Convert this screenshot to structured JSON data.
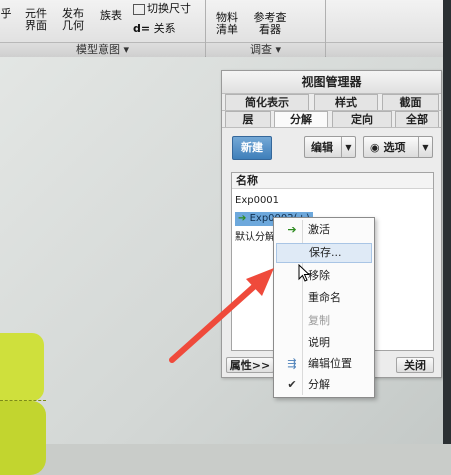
{
  "ribbon": {
    "partial_left": "乎",
    "yuanjian": "元件\n界面",
    "fabu": "发布\n几何",
    "jubiao": "族表",
    "qiehuan": "切换尺寸",
    "guanxi": "关系",
    "wuliao": "物料\n清单",
    "cankao": "参考查\n看器",
    "group_model": "模型意图 ▾",
    "group_investigate": "调查 ▾"
  },
  "panel": {
    "title": "视图管理器",
    "tabs_row1": [
      "简化表示",
      "样式",
      "截面"
    ],
    "tabs_row2": [
      "层",
      "分解",
      "定向",
      "全部"
    ],
    "new_label": "新建",
    "edit_label": "编辑",
    "options_label": "选项",
    "list_header": "名称",
    "rows": [
      "Exp0001",
      "Exp0002(+)",
      "默认分解"
    ],
    "properties_label": "属性>>",
    "close_label": "关闭"
  },
  "menu": {
    "items": [
      "激活",
      "保存...",
      "移除",
      "重命名",
      "复制",
      "说明",
      "编辑位置",
      "分解"
    ]
  },
  "icons": {
    "activate": "green-arrow-icon",
    "edit_position": "explode-move-icon",
    "explode": "checkmark-icon",
    "options": "eye-icon"
  },
  "colors": {
    "accent_blue": "#4a88c2",
    "highlight_blue": "#6da8dc",
    "model_green": "#c6d834",
    "annotation_red": "#ef4a3b"
  }
}
